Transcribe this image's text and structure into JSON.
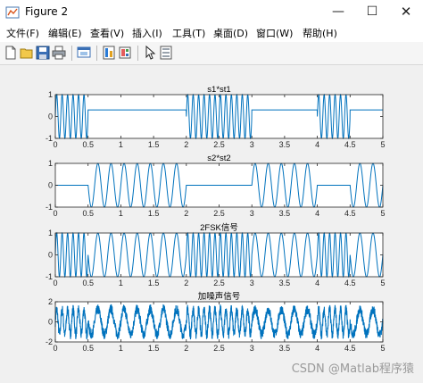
{
  "window": {
    "title": "Figure 2",
    "minimize_glyph": "—",
    "maximize_glyph": "☐",
    "close_glyph": "✕"
  },
  "menu": [
    "文件(F)",
    "编辑(E)",
    "查看(V)",
    "插入(I)",
    "工具(T)",
    "桌面(D)",
    "窗口(W)",
    "帮助(H)"
  ],
  "toolbar": [
    "new-figure-icon",
    "open-file-icon",
    "save-icon",
    "print-icon",
    "print-preview-icon",
    "link-plot-icon",
    "insert-colorbar-icon",
    "edit-plot-pointer-icon",
    "property-inspector-icon"
  ],
  "colors": {
    "line": "#0072bd"
  },
  "watermark": "CSDN @Matlab程序猿",
  "chart_data": [
    {
      "type": "line",
      "title": "s1*st1",
      "xlim": [
        0,
        5
      ],
      "ylim": [
        -1,
        1
      ],
      "xticks": [
        "0",
        "0.5",
        "1",
        "1.5",
        "2",
        "2.5",
        "3",
        "3.5",
        "4",
        "4.5",
        "5"
      ],
      "yticks": [
        "-1",
        "0",
        "1"
      ],
      "series": [
        {
          "bits": [
            1,
            0,
            0,
            0,
            1,
            1,
            0,
            0,
            1,
            0
          ],
          "frequency": 12,
          "off_value": 0.3
        }
      ]
    },
    {
      "type": "line",
      "title": "s2*st2",
      "xlim": [
        0,
        5
      ],
      "ylim": [
        -1,
        1
      ],
      "xticks": [
        "0",
        "0.5",
        "1",
        "1.5",
        "2",
        "2.5",
        "3",
        "3.5",
        "4",
        "4.5",
        "5"
      ],
      "yticks": [
        "-1",
        "0",
        "1"
      ],
      "series": [
        {
          "bits": [
            0,
            1,
            1,
            1,
            0,
            0,
            1,
            1,
            0,
            1
          ],
          "frequency": 5,
          "off_value": 0
        }
      ]
    },
    {
      "type": "line",
      "title": "2FSK信号",
      "xlim": [
        0,
        5
      ],
      "ylim": [
        -1,
        1
      ],
      "xticks": [
        "0",
        "0.5",
        "1",
        "1.5",
        "2",
        "2.5",
        "3",
        "3.5",
        "4",
        "4.5",
        "5"
      ],
      "yticks": [
        "-1",
        "0",
        "1"
      ],
      "series": [
        {
          "bits_f1": [
            1,
            0,
            0,
            0,
            1,
            1,
            0,
            0,
            1,
            0
          ],
          "frequency_f1": 12,
          "frequency_f2": 5
        }
      ]
    },
    {
      "type": "line",
      "title": "加噪声信号",
      "xlim": [
        0,
        5
      ],
      "ylim": [
        -2,
        2
      ],
      "xticks": [
        "0",
        "0.5",
        "1",
        "1.5",
        "2",
        "2.5",
        "3",
        "3.5",
        "4",
        "4.5",
        "5"
      ],
      "yticks": [
        "-2",
        "0",
        "2"
      ],
      "series": [
        {
          "bits_f1": [
            1,
            0,
            0,
            0,
            1,
            1,
            0,
            0,
            1,
            0
          ],
          "frequency_f1": 12,
          "frequency_f2": 5,
          "noise_amplitude": 0.5
        }
      ]
    }
  ]
}
